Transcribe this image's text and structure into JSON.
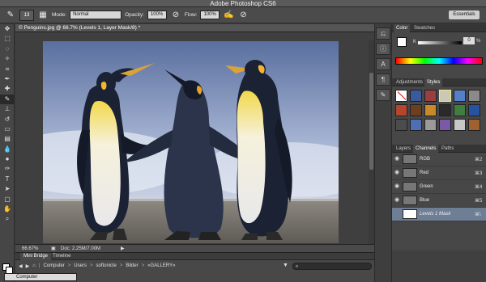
{
  "window": {
    "title": "Adobe Photoshop CS6"
  },
  "options_bar": {
    "brush_size": "13",
    "mode_label": "Mode:",
    "mode_value": "Normal",
    "opacity_label": "Opacity:",
    "opacity_value": "100%",
    "flow_label": "Flow:",
    "flow_value": "100%",
    "workspace_button": "Essentials"
  },
  "document": {
    "tab_title": "© Penguins.jpg @ 66.7% (Levels 1, Layer Mask/8) *",
    "zoom": "66.67%",
    "doc_info": "Doc: 2.25M/7.00M"
  },
  "mini_bridge": {
    "tabs": [
      "Mini Bridge",
      "Timeline"
    ],
    "path": [
      "Computer",
      "Users",
      "softonicle",
      "Bilder",
      "«GALLERY»"
    ],
    "location_select": "Computer"
  },
  "panels": {
    "color_tabs": [
      "Color",
      "Swatches"
    ],
    "k_label": "K",
    "k_value": "0",
    "k_unit": "%",
    "adjustment_tabs": [
      "Adjustments",
      "Styles"
    ],
    "layers_tabs": [
      "Layers",
      "Channels",
      "Paths"
    ],
    "channels": [
      {
        "name": "RGB",
        "shortcut": "⌘2"
      },
      {
        "name": "Red",
        "shortcut": "⌘3"
      },
      {
        "name": "Green",
        "shortcut": "⌘4"
      },
      {
        "name": "Blue",
        "shortcut": "⌘5"
      },
      {
        "name": "Levels 1 Mask",
        "shortcut": "⌘\\"
      }
    ]
  },
  "colors": {
    "accent_selected_row": "#6e7f95",
    "sky_top": "#5a6f9f",
    "sky_bottom": "#c9d4e8"
  }
}
